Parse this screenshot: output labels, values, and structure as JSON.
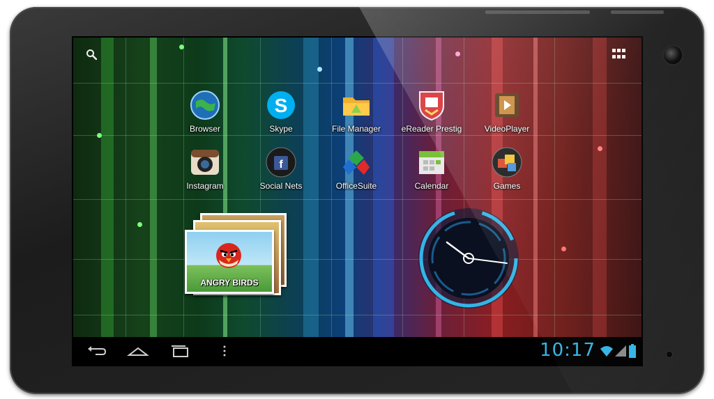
{
  "launcher": {
    "apps": [
      {
        "label": "Browser"
      },
      {
        "label": "Skype"
      },
      {
        "label": "File Manager"
      },
      {
        "label": "eReader Prestig"
      },
      {
        "label": "VideoPlayer"
      },
      {
        "label": "Instagram"
      },
      {
        "label": "Social Nets"
      },
      {
        "label": "OfficeSuite"
      },
      {
        "label": "Calendar"
      },
      {
        "label": "Games"
      }
    ],
    "photo_widget": {
      "caption": "ANGRY BIRDS"
    }
  },
  "status_bar": {
    "time": "10:17"
  },
  "colors": {
    "holo_blue": "#33b5e5",
    "nav_bg": "#000000"
  },
  "icons": [
    "search-icon",
    "apps-grid-icon",
    "back-icon",
    "home-icon",
    "recent-apps-icon",
    "menu-icon",
    "wifi-icon",
    "signal-icon",
    "battery-icon"
  ]
}
